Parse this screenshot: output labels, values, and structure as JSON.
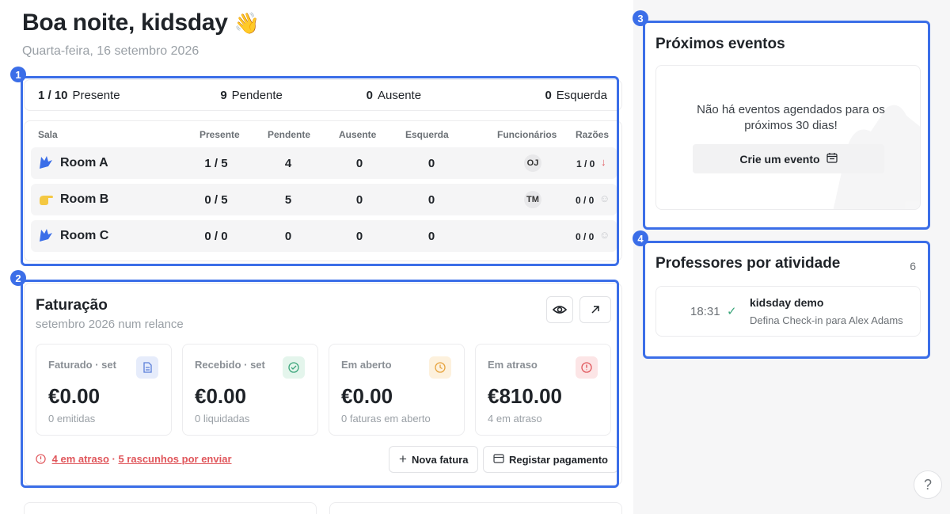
{
  "header": {
    "greeting": "Boa noite, kidsday",
    "wave_emoji": "👋",
    "date": "Quarta-feira, 16 setembro 2026"
  },
  "annotations": [
    "1",
    "2",
    "3",
    "4"
  ],
  "attendance": {
    "summary": [
      {
        "value": "1 / 10",
        "label": "Presente"
      },
      {
        "value": "9",
        "label": "Pendente"
      },
      {
        "value": "0",
        "label": "Ausente"
      },
      {
        "value": "0",
        "label": "Esquerda"
      }
    ],
    "columns": [
      "Sala",
      "Presente",
      "Pendente",
      "Ausente",
      "Esquerda",
      "Funcionários",
      "Razões"
    ],
    "rows": [
      {
        "room": "Room A",
        "icon": "blue-hand-icon",
        "presente": "1 / 5",
        "pendente": "4",
        "ausente": "0",
        "esquerda": "0",
        "staff": "OJ",
        "razoes": "1 / 0",
        "reason_icon": "arrow-down-icon"
      },
      {
        "room": "Room B",
        "icon": "yellow-hand-icon",
        "presente": "0 / 5",
        "pendente": "5",
        "ausente": "0",
        "esquerda": "0",
        "staff": "TM",
        "razoes": "0 / 0",
        "reason_icon": "smiley-icon"
      },
      {
        "room": "Room C",
        "icon": "blue-hand-icon",
        "presente": "0 / 0",
        "pendente": "0",
        "ausente": "0",
        "esquerda": "0",
        "staff": "",
        "razoes": "0 / 0",
        "reason_icon": "smiley-icon"
      }
    ]
  },
  "billing": {
    "title": "Faturação",
    "subtitle": "setembro 2026 num relance",
    "stats": [
      {
        "label": "Faturado · set",
        "value": "€0.00",
        "caption": "0 emitidas",
        "icon": "document-icon",
        "color": "#5b7fd9",
        "bg": "#e6ecfb"
      },
      {
        "label": "Recebido · set",
        "value": "€0.00",
        "caption": "0 liquidadas",
        "icon": "check-circle-icon",
        "color": "#3aa57a",
        "bg": "#e4f5ec"
      },
      {
        "label": "Em aberto",
        "value": "€0.00",
        "caption": "0 faturas em aberto",
        "icon": "clock-icon",
        "color": "#e6a23c",
        "bg": "#fdf1dd"
      },
      {
        "label": "Em atraso",
        "value": "€810.00",
        "caption": "4 em atraso",
        "icon": "alert-circle-icon",
        "color": "#e0565b",
        "bg": "#fce5e6"
      }
    ],
    "alert_overdue": "4 em atraso",
    "alert_sep": " · ",
    "alert_drafts": "5 rascunhos por enviar",
    "new_invoice": "Nova fatura",
    "register_payment": "Registar pagamento"
  },
  "events": {
    "title": "Próximos eventos",
    "empty": "Não há eventos agendados para os próximos 30 dias!",
    "create": "Crie um evento"
  },
  "teachers": {
    "title": "Professores por atividade",
    "count": "6",
    "item": {
      "time": "18:31",
      "name": "kidsday demo",
      "desc": "Defina Check-in para Alex Adams"
    }
  },
  "help": "?"
}
